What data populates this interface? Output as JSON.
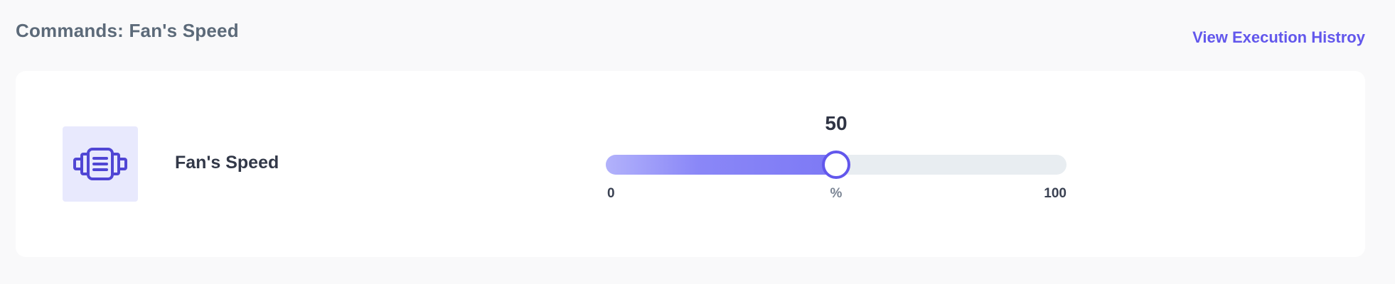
{
  "header": {
    "title": "Commands: Fan's Speed",
    "history_link": "View Execution Histroy"
  },
  "command": {
    "icon": "motor-icon",
    "label": "Fan's Speed",
    "slider": {
      "value": "50",
      "min": "0",
      "max": "100",
      "unit": "%",
      "fraction": 0.5
    }
  },
  "colors": {
    "accent": "#6257ec",
    "fill_start": "#b2b2fb",
    "fill_end": "#7d79f5",
    "track": "#e8edf1",
    "icon_bg": "#e8e9fd"
  }
}
